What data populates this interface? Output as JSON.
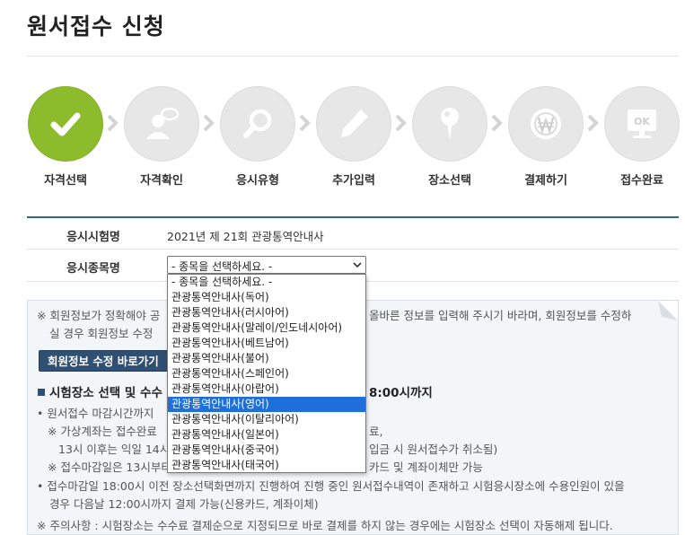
{
  "page": {
    "title": "원서접수 신청"
  },
  "steps": [
    {
      "label": "자격선택",
      "icon": "check-icon",
      "active": true
    },
    {
      "label": "자격확인",
      "icon": "user-icon",
      "active": false
    },
    {
      "label": "응시유형",
      "icon": "search-icon",
      "active": false
    },
    {
      "label": "추가입력",
      "icon": "pencil-icon",
      "active": false
    },
    {
      "label": "장소선택",
      "icon": "map-pin-icon",
      "active": false
    },
    {
      "label": "결제하기",
      "icon": "won-coin-icon",
      "active": false
    },
    {
      "label": "접수완료",
      "icon": "ok-monitor-icon",
      "active": false
    }
  ],
  "exam_info": {
    "exam_name_label": "응시시험명",
    "exam_name_value": "2021년 제 21회 관광통역안내사",
    "subject_label": "응시종목명",
    "subject_selected": "- 종목을 선택하세요. -"
  },
  "subject_options": [
    "- 종목을 선택하세요. -",
    "관광통역안내사(독어)",
    "관광통역안내사(러시아어)",
    "관광통역안내사(말레이/인도네시아어)",
    "관광통역안내사(베트남어)",
    "관광통역안내사(불어)",
    "관광통역안내사(스페인어)",
    "관광통역안내사(아랍어)",
    "관광통역안내사(영어)",
    "관광통역안내사(이탈리아어)",
    "관광통역안내사(일본어)",
    "관광통역안내사(중국어)",
    "관광통역안내사(태국어)"
  ],
  "highlighted_option": "관광통역안내사(영어)",
  "notice": {
    "line1a": "※ 회원정보가 정확해야 공",
    "line1b": "올바른 정보를 입력해 주시기 바라며, 회원정보를 수정하",
    "line2a": "실 경우 회원정보 수정 ",
    "edit_button": "회원정보 수정 바로가기",
    "heading_a": "시험장소 선택 및 수수",
    "heading_b": "8:00시까지",
    "bullet1": "• 원서접수 마감시간까지",
    "sub1a": "※ 가상계좌는 접수완료",
    "sub1b": "료,",
    "sub2a": "13시 이후는 익일 14시",
    "sub2b": "입금 시 원서접수가 취소됨)",
    "sub3a": "※ 접수마감일은 13시부터",
    "sub3b": "카드 및 계좌이체만 가능",
    "bullet2": "• 접수마감일 18:00시 이전 장소선택화면까지 진행하여 진행 중인 원서접수내역이 존재하고 시험응시장소에 수용인원이 있을",
    "bullet2b": "경우 다음날 12:00시까지 결제 가능(신용카드, 계좌이체)",
    "caution": "※ 주의사항 : 시험장소는 수수료 결제순으로 지정되므로 바로 결제를 하지 않는 경우에는 시험장소 선택이 자동해제 됩니다."
  },
  "colors": {
    "active_step": "#8cbb2c",
    "inactive_step": "#e7e7e7",
    "accent": "#2d6a8b",
    "button": "#2f4f73",
    "option_highlight": "#1e6fd9"
  }
}
